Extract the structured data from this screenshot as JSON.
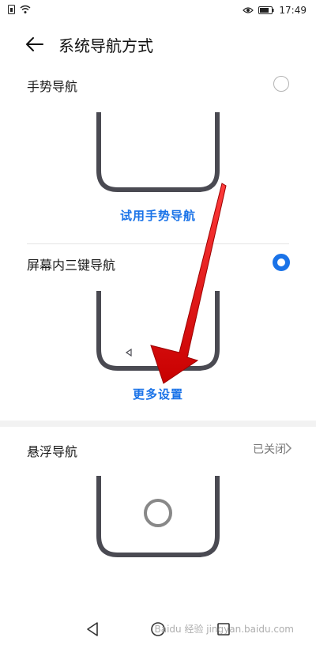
{
  "status_bar": {
    "time": "17:49",
    "battery_icon": "battery-icon",
    "wifi_icon": "wifi-icon",
    "eye_icon": "eye-icon"
  },
  "header": {
    "title": "系统导航方式",
    "back_icon": "back-arrow-icon"
  },
  "options": [
    {
      "label": "手势导航",
      "selected": false,
      "link": "试用手势导航"
    },
    {
      "label": "屏幕内三键导航",
      "selected": true,
      "link": "更多设置"
    },
    {
      "label": "悬浮导航",
      "status": "已关闭"
    }
  ],
  "accent": "#1a73e8",
  "annotation_arrow_color": "#e41414",
  "watermark": "Baidu 经验 jingyan.baidu.com",
  "system_nav": [
    "back-triangle-icon",
    "home-circle-icon",
    "recent-square-icon"
  ]
}
